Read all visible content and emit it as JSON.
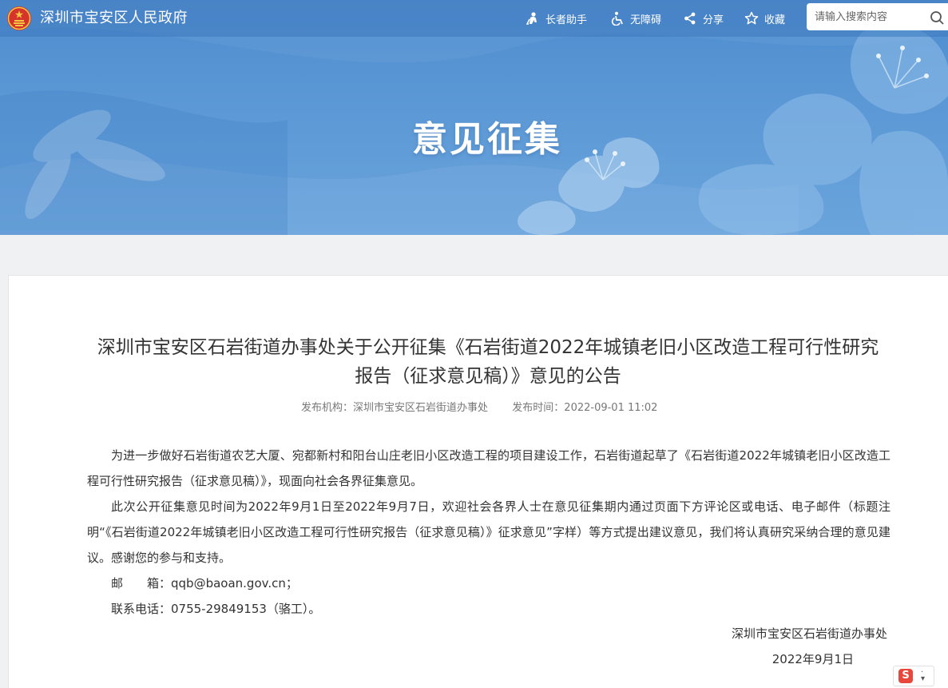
{
  "header": {
    "site_title": "深圳市宝安区人民政府",
    "tools": [
      {
        "label": "长者助手",
        "icon": "elder-icon"
      },
      {
        "label": "无障碍",
        "icon": "accessibility-icon"
      },
      {
        "label": "分享",
        "icon": "share-icon"
      },
      {
        "label": "收藏",
        "icon": "star-icon"
      }
    ],
    "search_placeholder": "请输入搜索内容"
  },
  "banner": {
    "title": "意见征集"
  },
  "article": {
    "title": "深圳市宝安区石岩街道办事处关于公开征集《石岩街道2022年城镇老旧小区改造工程可行性研究报告（征求意见稿）》意见的公告",
    "publisher": "发布机构：深圳市宝安区石岩街道办事处",
    "publish_time": "发布时间：2022-09-01 11:02",
    "paragraphs": [
      "为进一步做好石岩街道农艺大厦、宛都新村和阳台山庄老旧小区改造工程的项目建设工作，石岩街道起草了《石岩街道2022年城镇老旧小区改造工程可行性研究报告（征求意见稿）》，现面向社会各界征集意见。",
      "此次公开征集意见时间为2022年9月1日至2022年9月7日，欢迎社会各界人士在意见征集期内通过页面下方评论区或电话、电子邮件（标题注明“《石岩街道2022年城镇老旧小区改造工程可行性研究报告（征求意见稿）》征求意见”字样）等方式提出建议意见，我们将认真研究采纳合理的意见建议。感谢您的参与和支持。",
      "邮　　箱：qqb@baoan.gov.cn；",
      "联系电话：0755-29849153（骆工）。"
    ],
    "signature_org": "深圳市宝安区石岩街道办事处",
    "signature_date": "2022年9月1日"
  },
  "colors": {
    "banner_top": "#4d8ccf",
    "banner_bottom": "#6aa4dc",
    "text": "#333333",
    "meta": "#777777"
  }
}
